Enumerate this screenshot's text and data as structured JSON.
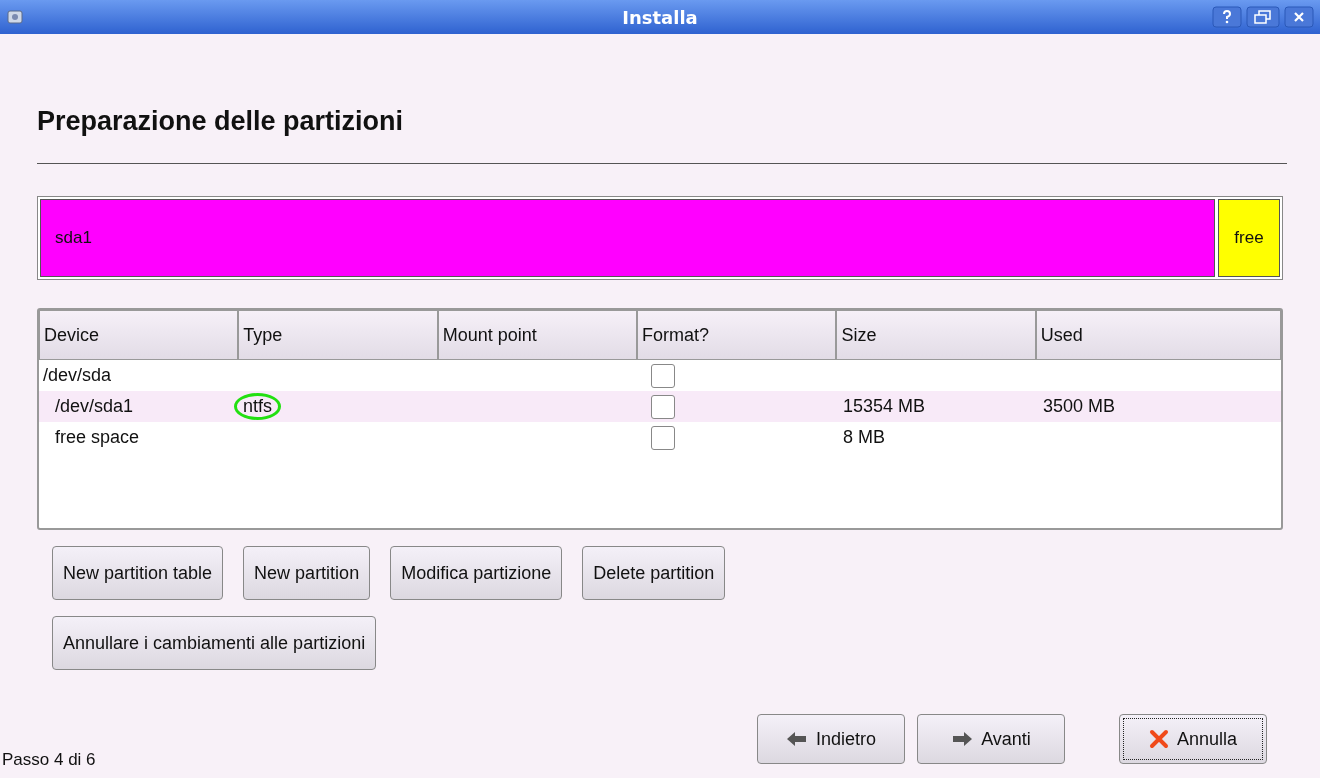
{
  "window": {
    "title": "Installa"
  },
  "heading": "Preparazione delle partizioni",
  "partition_bar": [
    {
      "label": "sda1",
      "color": "#ff00ff",
      "kind": "partition"
    },
    {
      "label": "free",
      "color": "#ffff00",
      "kind": "free"
    }
  ],
  "table": {
    "columns": [
      "Device",
      "Type",
      "Mount point",
      "Format?",
      "Size",
      "Used"
    ],
    "rows": [
      {
        "device": "/dev/sda",
        "format": false,
        "selected": false,
        "children": [
          {
            "device": "/dev/sda1",
            "type": "ntfs",
            "format": false,
            "size": "15354 MB",
            "used": "3500 MB",
            "selected": true,
            "circled": true
          },
          {
            "device": "free space",
            "format": false,
            "size": "8 MB",
            "selected": false
          }
        ]
      }
    ]
  },
  "partition_buttons": [
    [
      "New partition table",
      "New partition",
      "Modifica partizione",
      "Delete partition"
    ],
    [
      "Annullare i cambiamenti alle partizioni"
    ]
  ],
  "step": "Passo 4 di 6",
  "nav_buttons": [
    {
      "label": "Indietro",
      "kind": "back"
    },
    {
      "label": "Avanti",
      "kind": "next"
    },
    {
      "label": "Annulla",
      "kind": "cancel"
    }
  ]
}
